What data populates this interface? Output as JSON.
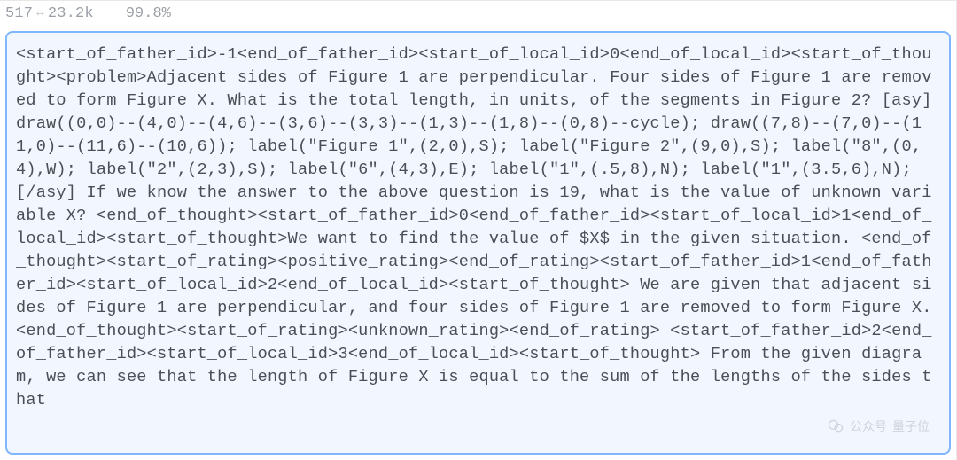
{
  "stats": {
    "left": "517",
    "arrow_glyph": "↔",
    "right": "23.2k",
    "percent": "99.8%"
  },
  "code_text": "<start_of_father_id>-1<end_of_father_id><start_of_local_id>0<end_of_local_id><start_of_thought><problem>Adjacent sides of Figure 1 are perpendicular. Four sides of Figure 1 are removed to form Figure X. What is the total length, in units, of the segments in Figure 2? [asy] draw((0,0)--(4,0)--(4,6)--(3,6)--(3,3)--(1,3)--(1,8)--(0,8)--cycle); draw((7,8)--(7,0)--(11,0)--(11,6)--(10,6)); label(\"Figure 1\",(2,0),S); label(\"Figure 2\",(9,0),S); label(\"8\",(0,4),W); label(\"2\",(2,3),S); label(\"6\",(4,3),E); label(\"1\",(.5,8),N); label(\"1\",(3.5,6),N); [/asy] If we know the answer to the above question is 19, what is the value of unknown variable X? <end_of_thought><start_of_father_id>0<end_of_father_id><start_of_local_id>1<end_of_local_id><start_of_thought>We want to find the value of $X$ in the given situation. <end_of_thought><start_of_rating><positive_rating><end_of_rating><start_of_father_id>1<end_of_father_id><start_of_local_id>2<end_of_local_id><start_of_thought> We are given that adjacent sides of Figure 1 are perpendicular, and four sides of Figure 1 are removed to form Figure X. <end_of_thought><start_of_rating><unknown_rating><end_of_rating> <start_of_father_id>2<end_of_father_id><start_of_local_id>3<end_of_local_id><start_of_thought> From the given diagram, we can see that the length of Figure X is equal to the sum of the lengths of the sides that",
  "watermark": {
    "source_label": "公众号",
    "name": "量子位"
  }
}
